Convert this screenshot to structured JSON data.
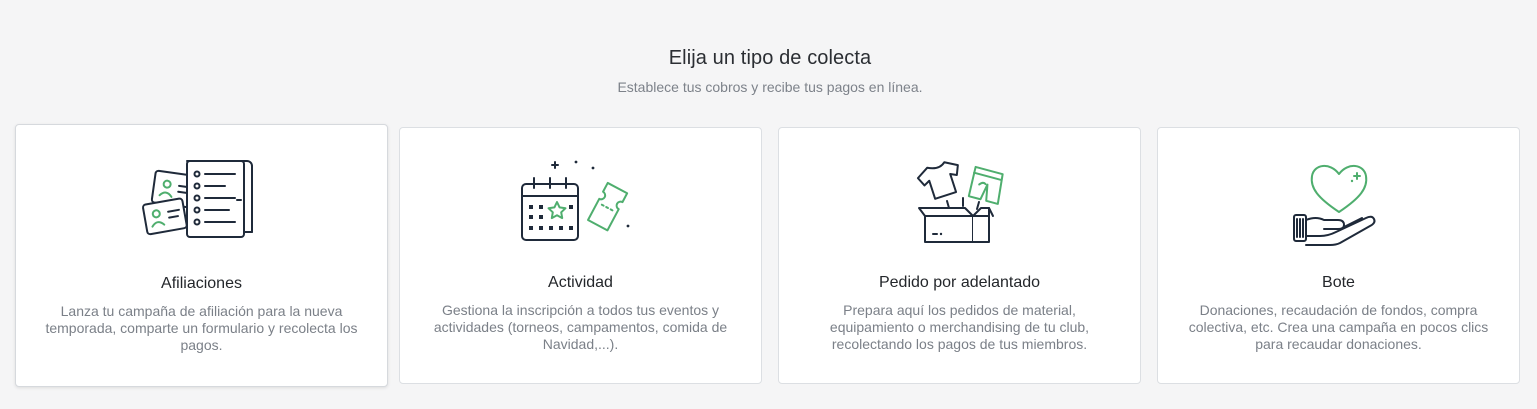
{
  "header": {
    "title": "Elija un tipo de colecta",
    "subtitle": "Establece tus cobros y recibe tus pagos en línea."
  },
  "cards": [
    {
      "title": "Afiliaciones",
      "description": "Lanza tu campaña de afiliación para la nueva temporada, comparte un formulario y recolecta los pagos.",
      "icon": "membership-cards-icon"
    },
    {
      "title": "Actividad",
      "description": "Gestiona la inscripción a todos tus eventos y actividades (torneos, campamentos, comida de Navidad,...).",
      "icon": "calendar-ticket-icon"
    },
    {
      "title": "Pedido por adelantado",
      "description": "Prepara aquí los pedidos de material, equipamiento o merchandising de tu club, recolectando los pagos de tus miembros.",
      "icon": "merch-box-icon"
    },
    {
      "title": "Bote",
      "description": "Donaciones, recaudación de fondos, compra colectiva, etc. Crea una campaña en pocos clics para recaudar donaciones.",
      "icon": "heart-hand-icon"
    }
  ],
  "colors": {
    "accent": "#4fae6e",
    "ink": "#1f2a3a",
    "background": "#f5f5f6"
  }
}
